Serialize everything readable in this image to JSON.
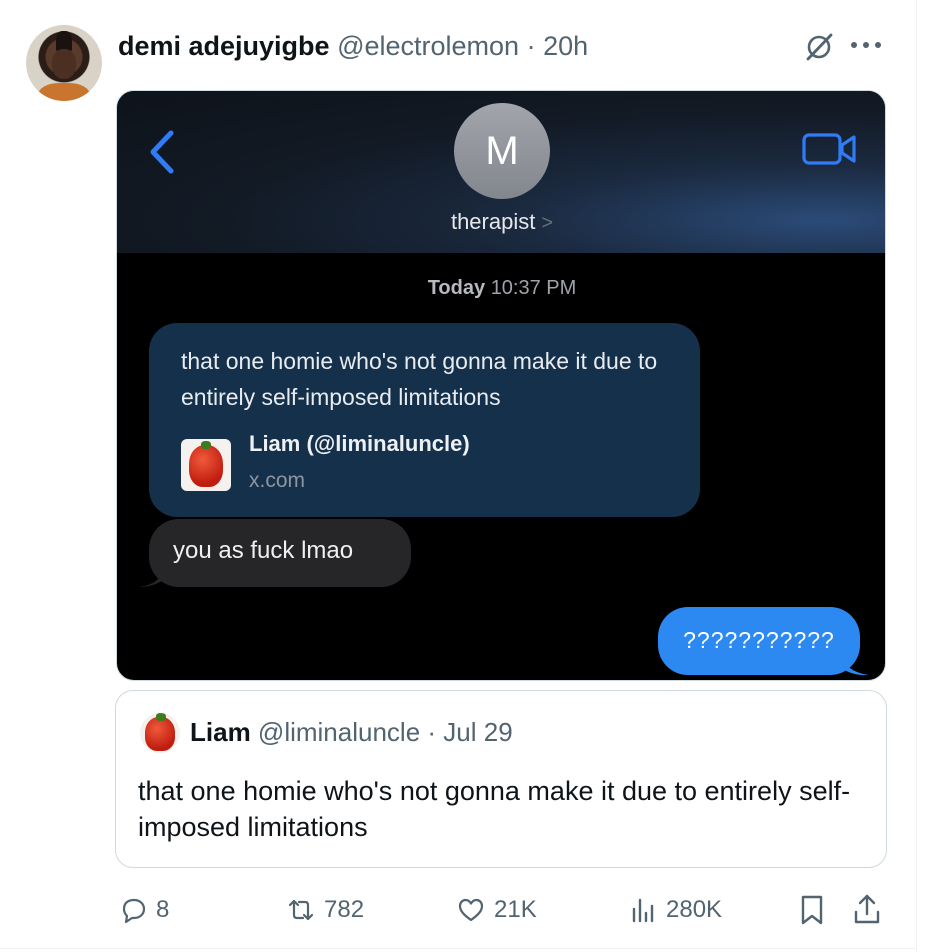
{
  "tweet": {
    "display_name": "demi adejuyigbe",
    "handle": "@electrolemon",
    "separator": "·",
    "time": "20h",
    "icons": {
      "grok": "grok-icon",
      "more": "more-icon"
    }
  },
  "media": {
    "contact_initial": "M",
    "contact_name": "therapist",
    "contact_chevron": ">",
    "timestamp_day": "Today",
    "timestamp_time": "10:37 PM",
    "link_message": "that one homie who's not gonna make it due to entirely self-imposed limitations",
    "link_title": "Liam (@liminaluncle)",
    "link_domain": "x.com",
    "received_message": "you as fuck lmao",
    "sent_message": "???????????",
    "colors": {
      "sent_bubble": "#2c89f2",
      "received_bubble": "#262628",
      "link_bubble": "#15304a",
      "ios_accent": "#2f7cf6"
    }
  },
  "quote": {
    "name": "Liam",
    "handle": "@liminaluncle",
    "separator": "·",
    "date": "Jul 29",
    "text": "that one homie who's not gonna make it due to entirely self-imposed limitations"
  },
  "actions": {
    "replies": "8",
    "retweets": "782",
    "likes": "21K",
    "views": "280K"
  }
}
